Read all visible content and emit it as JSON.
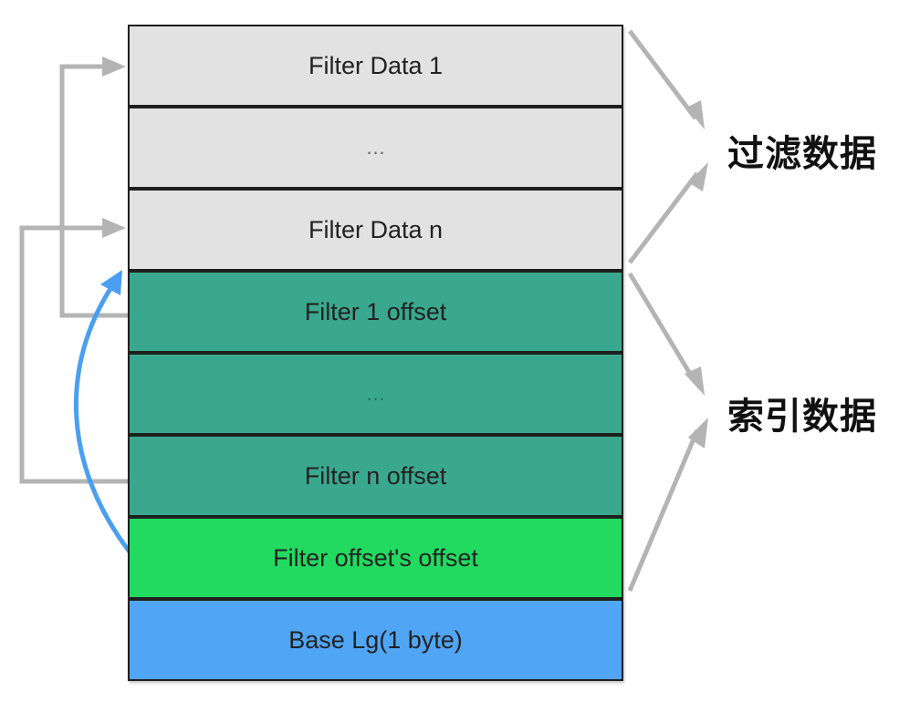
{
  "blocks": [
    {
      "label": "Filter Data 1",
      "color": "#e2e2e2"
    },
    {
      "label": "…",
      "color": "#e2e2e2"
    },
    {
      "label": "Filter Data n",
      "color": "#e2e2e2"
    },
    {
      "label": "Filter 1 offset",
      "color": "#3aa88e"
    },
    {
      "label": "…",
      "color": "#3aa88e"
    },
    {
      "label": "Filter n offset",
      "color": "#3aa88e"
    },
    {
      "label": "Filter offset's offset",
      "color": "#21da5f"
    },
    {
      "label": "Base Lg(1 byte)",
      "color": "#50a5f5"
    }
  ],
  "groups": {
    "filter_data": "过滤数据",
    "index_data": "索引数据"
  },
  "colors": {
    "arrow_gray": "#b4b4b4",
    "arrow_blue": "#4a9ff0",
    "border": "#1f1f1f"
  }
}
